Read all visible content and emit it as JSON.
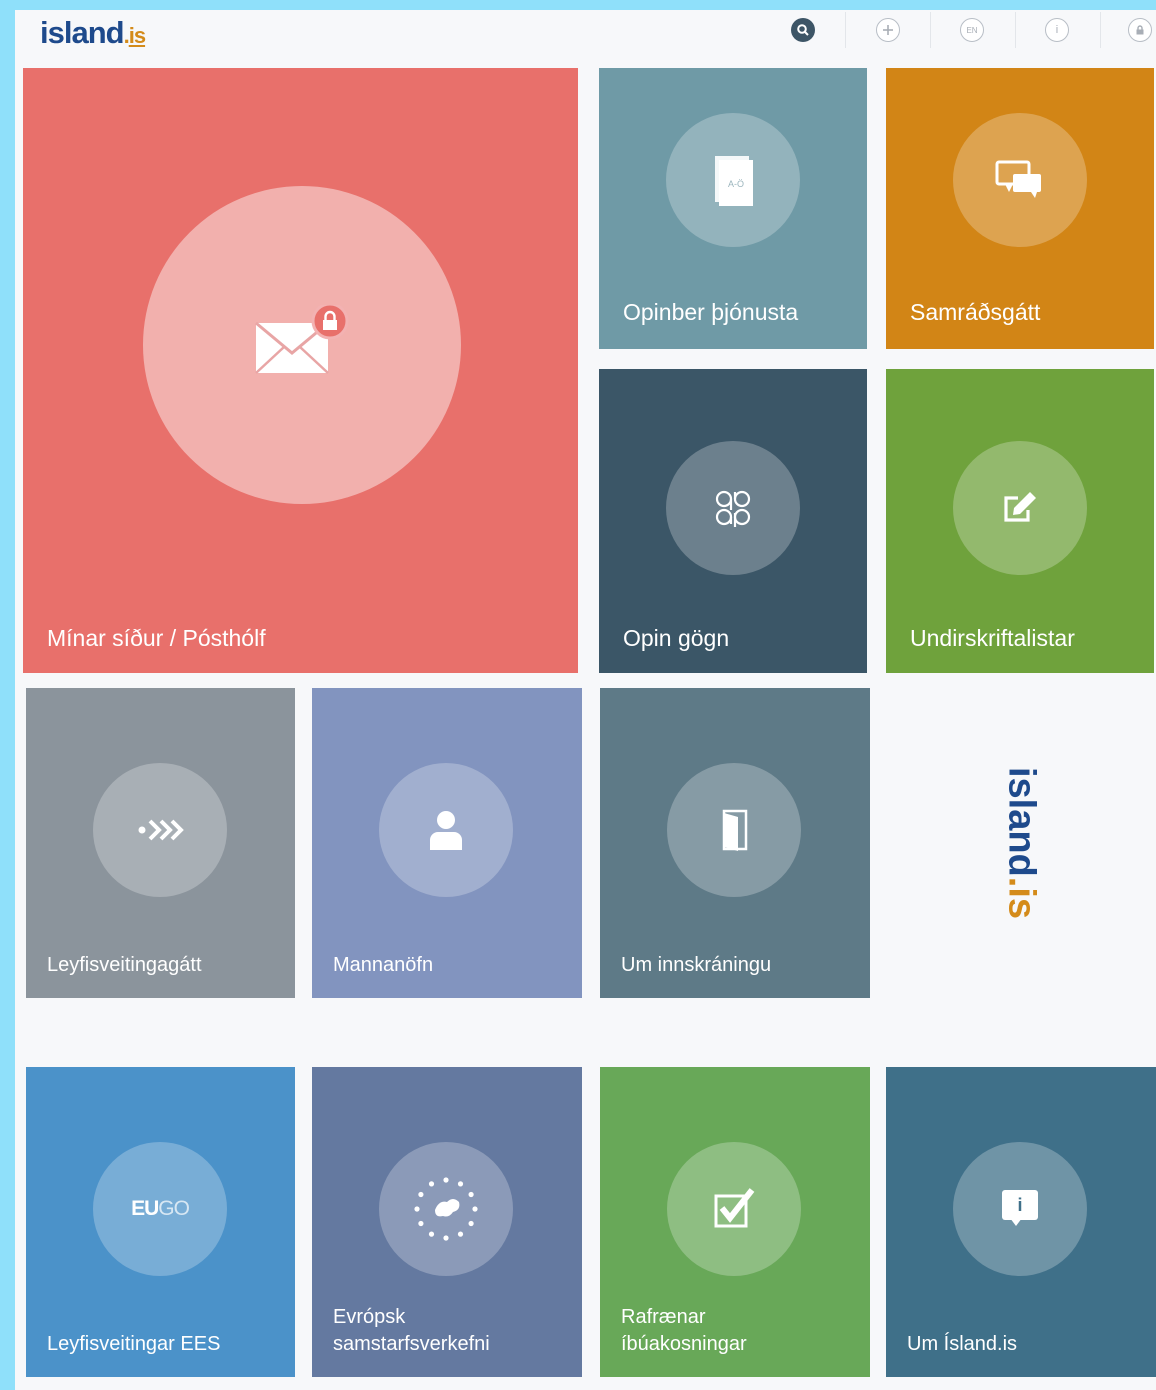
{
  "header": {
    "logo_main": "island",
    "logo_dot": ".",
    "logo_suffix": "is",
    "icons": [
      "search-icon",
      "plus-icon",
      "language-icon",
      "info-icon",
      "lock-icon"
    ],
    "language_label": "EN",
    "info_label": "i"
  },
  "tiles": {
    "minar_sidur": {
      "label": "Mínar síður / Pósthólf",
      "color": "#e8706b",
      "icon": "mail-lock-icon"
    },
    "opinber": {
      "label": "Opinber þjónusta",
      "color": "#6f9aa6",
      "icon": "book-icon",
      "icon_text": "A-Ö"
    },
    "samrad": {
      "label": "Samráðsgátt",
      "color": "#d28516",
      "icon": "chat-icon"
    },
    "opin_gogn": {
      "label": "Opin gögn",
      "color": "#3b5667",
      "icon": "data-icon"
    },
    "undirskrift": {
      "label": "Undirskriftalistar",
      "color": "#6fa23c",
      "icon": "edit-icon"
    },
    "leyfis": {
      "label": "Leyfisveitingagátt",
      "color": "#8b949c",
      "icon": "arrows-icon"
    },
    "mannanofn": {
      "label": "Mannanöfn",
      "color": "#8294bf",
      "icon": "person-icon"
    },
    "innskraning": {
      "label": "Um innskráningu",
      "color": "#5e7a87",
      "icon": "door-icon"
    },
    "ees": {
      "label": "Leyfisveitingar EES",
      "color": "#4b92c9",
      "icon": "eugo-icon",
      "icon_text_a": "EU",
      "icon_text_b": "GO"
    },
    "evropsk": {
      "label_1": "Evrópsk",
      "label_2": "samstarfsverkefni",
      "color": "#6479a0",
      "icon": "eu-stars-icon"
    },
    "rafraenar": {
      "label_1": "Rafrænar",
      "label_2": "íbúakosningar",
      "color": "#68a858",
      "icon": "checkbox-icon"
    },
    "um_island": {
      "label": "Um Ísland.is",
      "color": "#3f7089",
      "icon": "info-icon",
      "icon_text": "i"
    }
  },
  "side_logo": {
    "main": "island",
    "dot": ".",
    "suffix": "is"
  }
}
